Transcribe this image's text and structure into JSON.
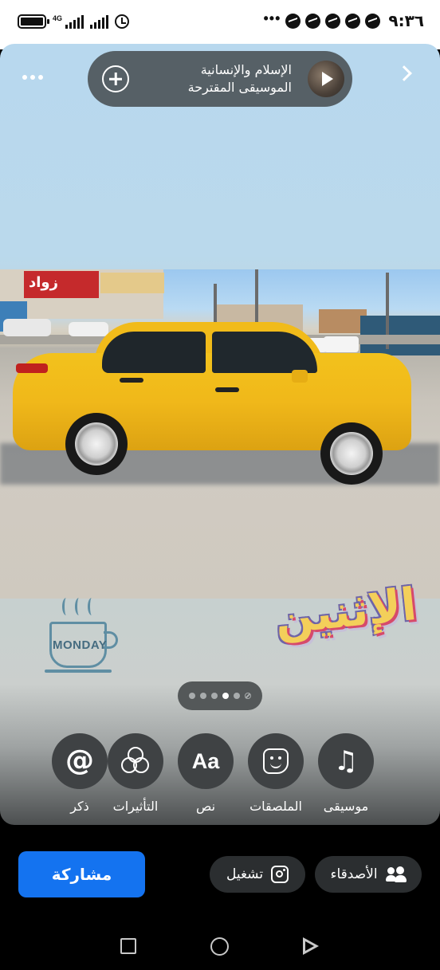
{
  "status_bar": {
    "time": "٩:٣٦",
    "network_label": "4G",
    "icons": [
      "battery-icon",
      "signal-icon",
      "signal-icon",
      "alarm-icon",
      "more-notifications-icon",
      "messenger-icon",
      "messenger-icon",
      "messenger-icon",
      "messenger-icon",
      "messenger-icon"
    ]
  },
  "music": {
    "title": "الإسلام والإنسانية",
    "subtitle": "الموسيقى المقترحة"
  },
  "stickers": {
    "mug_text": "MONDAY",
    "day_text": "الإثنين"
  },
  "photo": {
    "shop_sign": "زواد"
  },
  "pagination": {
    "count": 5,
    "active_index": 3
  },
  "tools": [
    {
      "label": "ذكر",
      "icon": "mention-icon"
    },
    {
      "label": "التأثيرات",
      "icon": "effects-icon"
    },
    {
      "label": "نص",
      "icon": "text-icon",
      "glyph": "Aa"
    },
    {
      "label": "الملصقات",
      "icon": "sticker-icon"
    },
    {
      "label": "موسيقى",
      "icon": "music-icon"
    }
  ],
  "actions": {
    "share_label": "مشاركة",
    "play_label": "تشغيل",
    "friends_label": "الأصدقاء"
  },
  "colors": {
    "share_button": "#1473f0",
    "taxi_yellow": "#f1bb1a"
  }
}
